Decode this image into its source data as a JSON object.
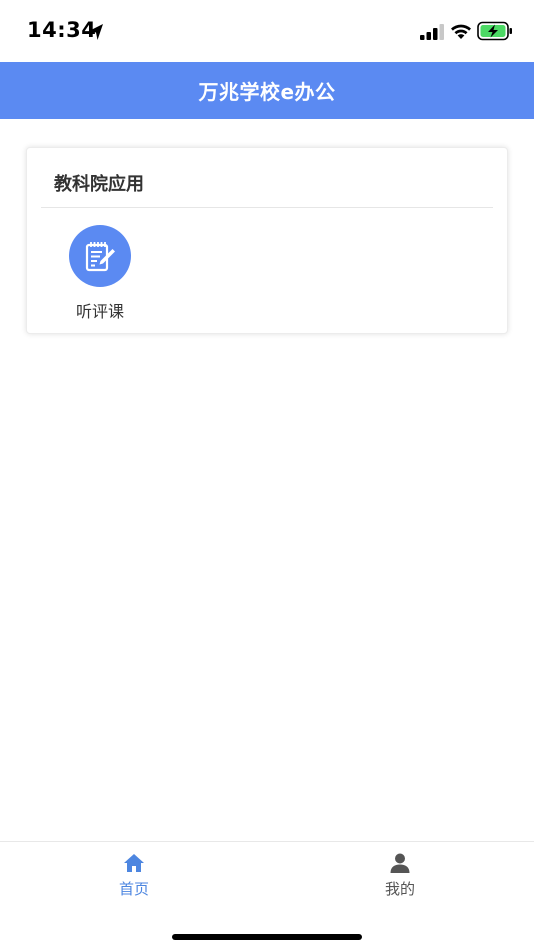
{
  "status_bar": {
    "time": "14:34"
  },
  "header": {
    "title": "万兆学校e办公"
  },
  "card": {
    "title": "教科院应用",
    "apps": [
      {
        "label": "听评课",
        "icon": "notepad-pencil-icon"
      }
    ]
  },
  "tab_bar": {
    "tabs": [
      {
        "label": "首页",
        "icon": "home-icon",
        "active": true
      },
      {
        "label": "我的",
        "icon": "user-icon",
        "active": false
      }
    ]
  },
  "colors": {
    "accent": "#5b8af2",
    "tab_active": "#4d86e0",
    "tab_inactive": "#555555",
    "text": "#333333"
  }
}
